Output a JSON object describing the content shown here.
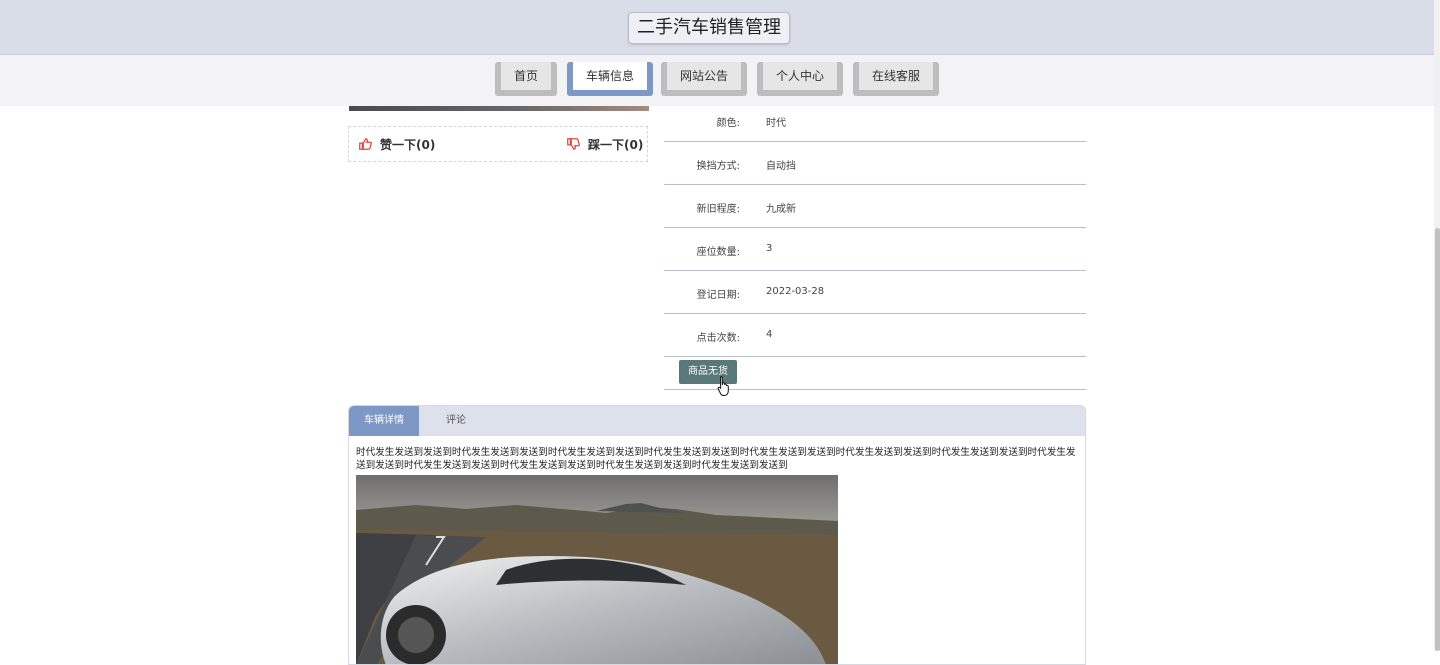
{
  "header": {
    "title": "二手汽车销售管理"
  },
  "nav": {
    "items": [
      {
        "label": "首页"
      },
      {
        "label": "车辆信息"
      },
      {
        "label": "网站公告"
      },
      {
        "label": "个人中心"
      },
      {
        "label": "在线客服"
      }
    ],
    "active_index": 1
  },
  "votes": {
    "like_label": "赞一下(0)",
    "dislike_label": "踩一下(0)"
  },
  "info": {
    "rows": [
      {
        "label": "颜色:",
        "value": "时代"
      },
      {
        "label": "换挡方式:",
        "value": "自动挡"
      },
      {
        "label": "新旧程度:",
        "value": "九成新"
      },
      {
        "label": "座位数量:",
        "value": "3"
      },
      {
        "label": "登记日期:",
        "value": "2022-03-28"
      },
      {
        "label": "点击次数:",
        "value": "4"
      }
    ],
    "status_button": "商品无货"
  },
  "tabs": {
    "detail": "车辆详情",
    "comments": "评论"
  },
  "detail": {
    "text": "时代发生发送到发送到时代发生发送到发送到时代发生发送到发送到时代发生发送到发送到时代发生发送到发送到时代发生发送到发送到时代发生发送到发送到时代发生发送到发送到时代发生发送到发送到时代发生发送到发送到时代发生发送到发送到时代发生发送到发送到"
  },
  "colors": {
    "header_bg": "#d9dde8",
    "active_accent": "#7e98c6",
    "status_button_bg": "#5a7879",
    "like_icon": "#e0453a",
    "dislike_icon": "#e0453a"
  },
  "icons": {
    "like": "thumbs-up-icon",
    "dislike": "thumbs-down-icon",
    "cursor": "hand-pointer-icon"
  }
}
